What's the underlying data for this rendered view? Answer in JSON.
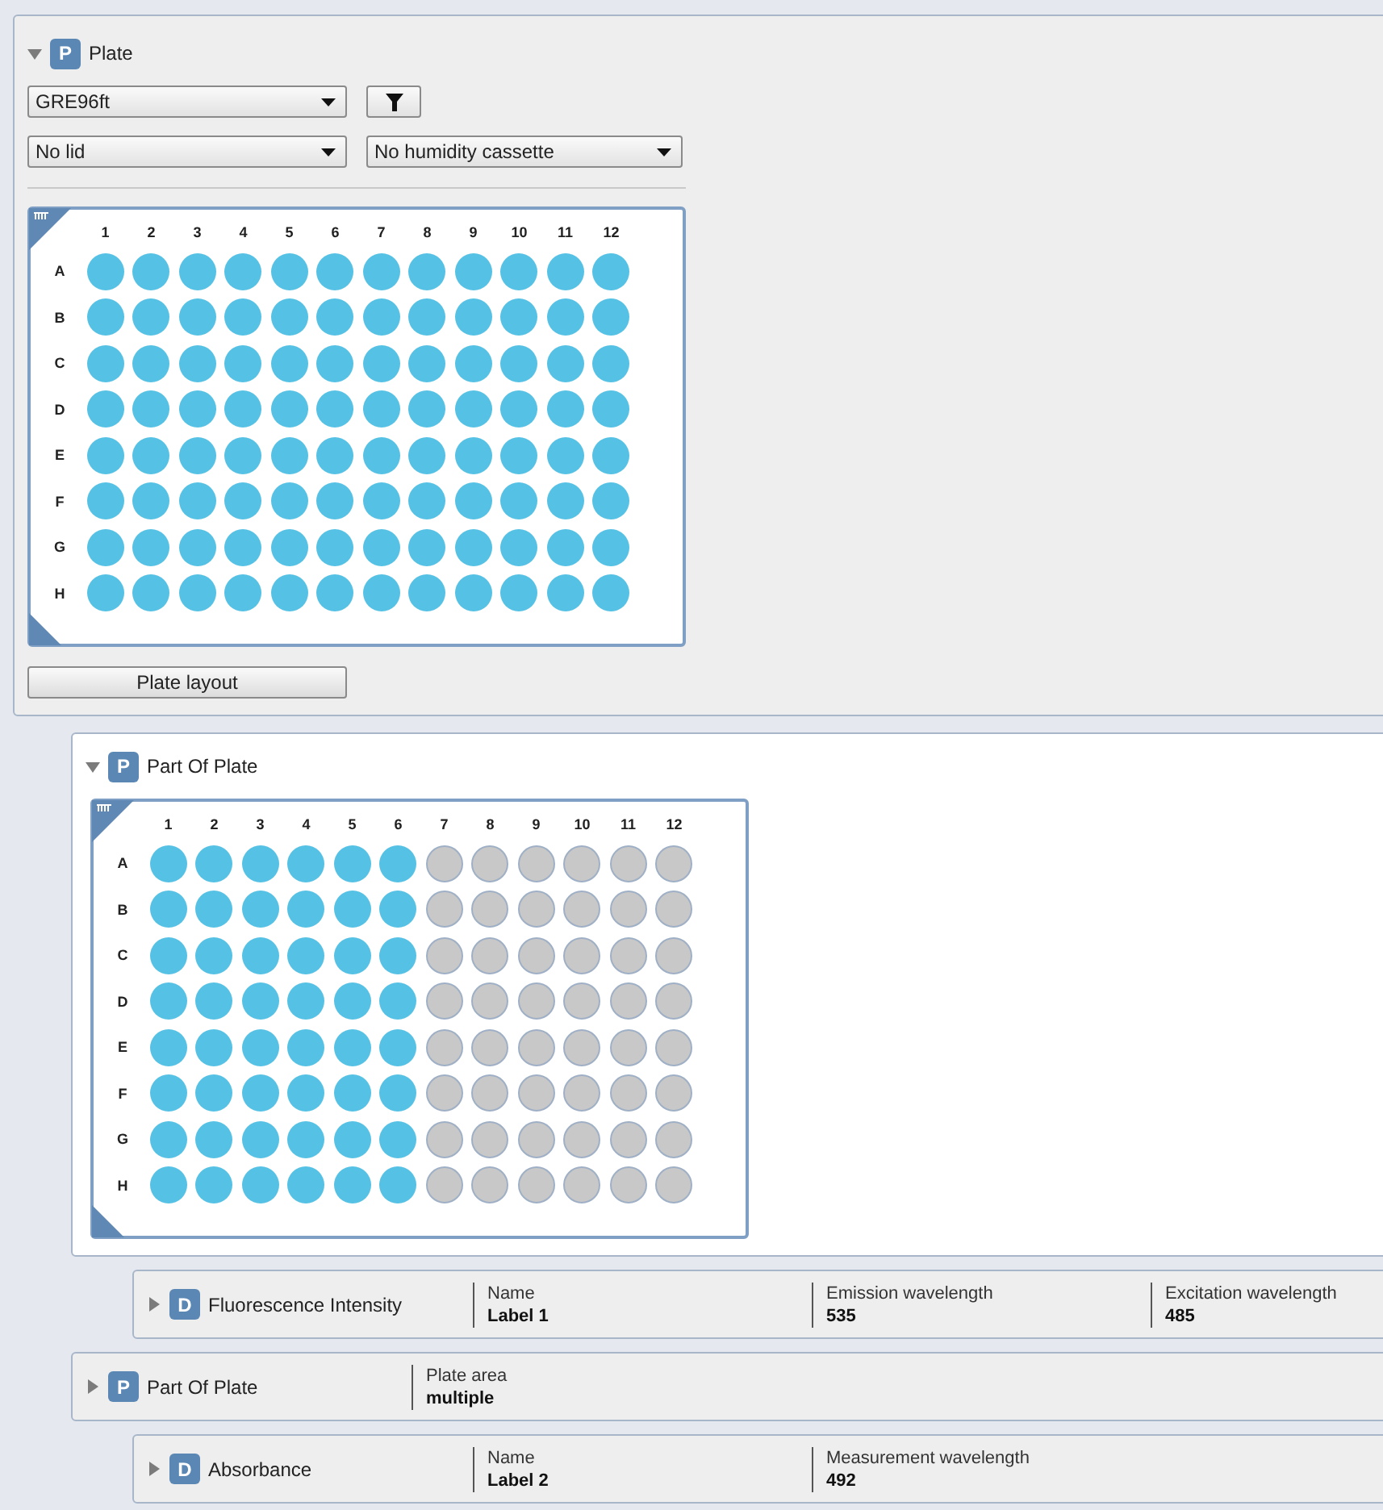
{
  "plate_section": {
    "expanded": true,
    "badge": "P",
    "title": "Plate",
    "plate_type": "GRE96ft",
    "lid": "No lid",
    "humidity": "No humidity cassette",
    "layout_button": "Plate layout",
    "plate": {
      "columns": [
        "1",
        "2",
        "3",
        "4",
        "5",
        "6",
        "7",
        "8",
        "9",
        "10",
        "11",
        "12"
      ],
      "rows": [
        {
          "label": "A",
          "wells": [
            {
              "selected": true
            },
            {
              "selected": true
            },
            {
              "selected": true
            },
            {
              "selected": true
            },
            {
              "selected": true
            },
            {
              "selected": true
            },
            {
              "selected": true
            },
            {
              "selected": true
            },
            {
              "selected": true
            },
            {
              "selected": true
            },
            {
              "selected": true
            },
            {
              "selected": true
            }
          ]
        },
        {
          "label": "B",
          "wells": [
            {
              "selected": true
            },
            {
              "selected": true
            },
            {
              "selected": true
            },
            {
              "selected": true
            },
            {
              "selected": true
            },
            {
              "selected": true
            },
            {
              "selected": true
            },
            {
              "selected": true
            },
            {
              "selected": true
            },
            {
              "selected": true
            },
            {
              "selected": true
            },
            {
              "selected": true
            }
          ]
        },
        {
          "label": "C",
          "wells": [
            {
              "selected": true
            },
            {
              "selected": true
            },
            {
              "selected": true
            },
            {
              "selected": true
            },
            {
              "selected": true
            },
            {
              "selected": true
            },
            {
              "selected": true
            },
            {
              "selected": true
            },
            {
              "selected": true
            },
            {
              "selected": true
            },
            {
              "selected": true
            },
            {
              "selected": true
            }
          ]
        },
        {
          "label": "D",
          "wells": [
            {
              "selected": true
            },
            {
              "selected": true
            },
            {
              "selected": true
            },
            {
              "selected": true
            },
            {
              "selected": true
            },
            {
              "selected": true
            },
            {
              "selected": true
            },
            {
              "selected": true
            },
            {
              "selected": true
            },
            {
              "selected": true
            },
            {
              "selected": true
            },
            {
              "selected": true
            }
          ]
        },
        {
          "label": "E",
          "wells": [
            {
              "selected": true
            },
            {
              "selected": true
            },
            {
              "selected": true
            },
            {
              "selected": true
            },
            {
              "selected": true
            },
            {
              "selected": true
            },
            {
              "selected": true
            },
            {
              "selected": true
            },
            {
              "selected": true
            },
            {
              "selected": true
            },
            {
              "selected": true
            },
            {
              "selected": true
            }
          ]
        },
        {
          "label": "F",
          "wells": [
            {
              "selected": true
            },
            {
              "selected": true
            },
            {
              "selected": true
            },
            {
              "selected": true
            },
            {
              "selected": true
            },
            {
              "selected": true
            },
            {
              "selected": true
            },
            {
              "selected": true
            },
            {
              "selected": true
            },
            {
              "selected": true
            },
            {
              "selected": true
            },
            {
              "selected": true
            }
          ]
        },
        {
          "label": "G",
          "wells": [
            {
              "selected": true
            },
            {
              "selected": true
            },
            {
              "selected": true
            },
            {
              "selected": true
            },
            {
              "selected": true
            },
            {
              "selected": true
            },
            {
              "selected": true
            },
            {
              "selected": true
            },
            {
              "selected": true
            },
            {
              "selected": true
            },
            {
              "selected": true
            },
            {
              "selected": true
            }
          ]
        },
        {
          "label": "H",
          "wells": [
            {
              "selected": true
            },
            {
              "selected": true
            },
            {
              "selected": true
            },
            {
              "selected": true
            },
            {
              "selected": true
            },
            {
              "selected": true
            },
            {
              "selected": true
            },
            {
              "selected": true
            },
            {
              "selected": true
            },
            {
              "selected": true
            },
            {
              "selected": true
            },
            {
              "selected": true
            }
          ]
        }
      ]
    }
  },
  "part_of_plate": {
    "expanded": true,
    "badge": "P",
    "title": "Part Of Plate",
    "plate": {
      "columns": [
        "1",
        "2",
        "3",
        "4",
        "5",
        "6",
        "7",
        "8",
        "9",
        "10",
        "11",
        "12"
      ],
      "rows": [
        {
          "label": "A",
          "wells": [
            {
              "selected": true
            },
            {
              "selected": true
            },
            {
              "selected": true
            },
            {
              "selected": true
            },
            {
              "selected": true
            },
            {
              "selected": true
            },
            {
              "selected": false
            },
            {
              "selected": false
            },
            {
              "selected": false
            },
            {
              "selected": false
            },
            {
              "selected": false
            },
            {
              "selected": false
            }
          ]
        },
        {
          "label": "B",
          "wells": [
            {
              "selected": true
            },
            {
              "selected": true
            },
            {
              "selected": true
            },
            {
              "selected": true
            },
            {
              "selected": true
            },
            {
              "selected": true
            },
            {
              "selected": false
            },
            {
              "selected": false
            },
            {
              "selected": false
            },
            {
              "selected": false
            },
            {
              "selected": false
            },
            {
              "selected": false
            }
          ]
        },
        {
          "label": "C",
          "wells": [
            {
              "selected": true
            },
            {
              "selected": true
            },
            {
              "selected": true
            },
            {
              "selected": true
            },
            {
              "selected": true
            },
            {
              "selected": true
            },
            {
              "selected": false
            },
            {
              "selected": false
            },
            {
              "selected": false
            },
            {
              "selected": false
            },
            {
              "selected": false
            },
            {
              "selected": false
            }
          ]
        },
        {
          "label": "D",
          "wells": [
            {
              "selected": true
            },
            {
              "selected": true
            },
            {
              "selected": true
            },
            {
              "selected": true
            },
            {
              "selected": true
            },
            {
              "selected": true
            },
            {
              "selected": false
            },
            {
              "selected": false
            },
            {
              "selected": false
            },
            {
              "selected": false
            },
            {
              "selected": false
            },
            {
              "selected": false
            }
          ]
        },
        {
          "label": "E",
          "wells": [
            {
              "selected": true
            },
            {
              "selected": true
            },
            {
              "selected": true
            },
            {
              "selected": true
            },
            {
              "selected": true
            },
            {
              "selected": true
            },
            {
              "selected": false
            },
            {
              "selected": false
            },
            {
              "selected": false
            },
            {
              "selected": false
            },
            {
              "selected": false
            },
            {
              "selected": false
            }
          ]
        },
        {
          "label": "F",
          "wells": [
            {
              "selected": true
            },
            {
              "selected": true
            },
            {
              "selected": true
            },
            {
              "selected": true
            },
            {
              "selected": true
            },
            {
              "selected": true
            },
            {
              "selected": false
            },
            {
              "selected": false
            },
            {
              "selected": false
            },
            {
              "selected": false
            },
            {
              "selected": false
            },
            {
              "selected": false
            }
          ]
        },
        {
          "label": "G",
          "wells": [
            {
              "selected": true
            },
            {
              "selected": true
            },
            {
              "selected": true
            },
            {
              "selected": true
            },
            {
              "selected": true
            },
            {
              "selected": true
            },
            {
              "selected": false
            },
            {
              "selected": false
            },
            {
              "selected": false
            },
            {
              "selected": false
            },
            {
              "selected": false
            },
            {
              "selected": false
            }
          ]
        },
        {
          "label": "H",
          "wells": [
            {
              "selected": true
            },
            {
              "selected": true
            },
            {
              "selected": true
            },
            {
              "selected": true
            },
            {
              "selected": true
            },
            {
              "selected": true
            },
            {
              "selected": false
            },
            {
              "selected": false
            },
            {
              "selected": false
            },
            {
              "selected": false
            },
            {
              "selected": false
            },
            {
              "selected": false
            }
          ]
        }
      ]
    }
  },
  "steps": [
    {
      "kind": "measurement",
      "expanded": false,
      "badge": "D",
      "title": "Fluorescence Intensity",
      "fields": [
        {
          "label": "Name",
          "value": "Label 1"
        },
        {
          "label": "Emission wavelength",
          "value": "535"
        },
        {
          "label": "Excitation wavelength",
          "value": "485"
        }
      ]
    },
    {
      "kind": "part",
      "expanded": false,
      "badge": "P",
      "title": "Part Of Plate",
      "fields": [
        {
          "label": "Plate area",
          "value": "multiple"
        }
      ]
    },
    {
      "kind": "measurement",
      "expanded": false,
      "badge": "D",
      "title": "Absorbance",
      "fields": [
        {
          "label": "Name",
          "value": "Label 2"
        },
        {
          "label": "Measurement wavelength",
          "value": "492"
        }
      ]
    }
  ]
}
